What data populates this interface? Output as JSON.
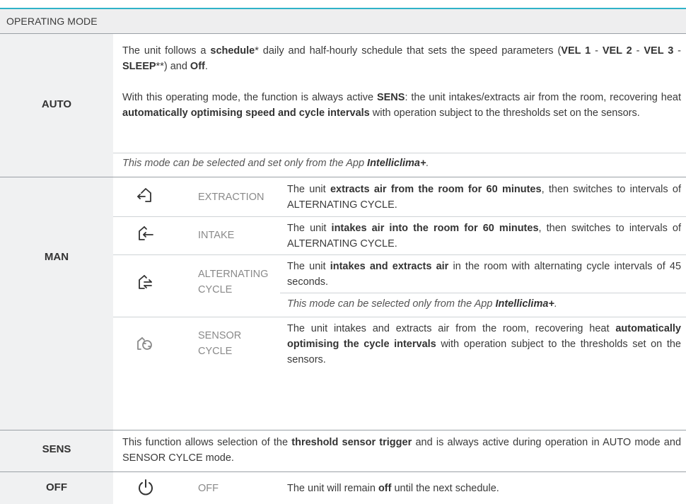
{
  "header": {
    "title": "OPERATING MODE"
  },
  "auto": {
    "label": "AUTO",
    "p1": {
      "a": "The unit follows a ",
      "b1": "schedule",
      "c": "* daily and half-hourly schedule that sets the speed parameters (",
      "b2": "VEL 1",
      "d": " - ",
      "b3": "VEL 2",
      "e": " - ",
      "b4": "VEL 3",
      "f": " - ",
      "b5": "SLEEP",
      "g": "**) and ",
      "b6": "Off",
      "h": "."
    },
    "p2": {
      "a": "With this operating mode, the function is always active ",
      "b1": "SENS",
      "c": ": the unit intakes/extracts air from the room, recovering heat ",
      "b2": "automatically optimising speed and cycle intervals",
      "d": " with operation subject to the thresholds set on the sensors."
    },
    "note": {
      "a": "This mode can be selected and set only from the App ",
      "b": "Intelliclima+",
      "c": "."
    }
  },
  "man": {
    "label": "MAN",
    "modes": [
      {
        "icon": "extraction-icon",
        "name": "EXTRACTION",
        "t1": "The unit ",
        "b1": "extracts air from the room for 60 minutes",
        "t2": ", then switches to intervals of ALTERNATING CYCLE."
      },
      {
        "icon": "intake-icon",
        "name": "INTAKE",
        "t1": "The unit ",
        "b1": "intakes air into the room for 60 minutes",
        "t2": ", then switches to intervals of ALTERNATING CYCLE."
      },
      {
        "icon": "alternating-cycle-icon",
        "name": "ALTERNATING CYCLE",
        "t1": "The unit ",
        "b1": "intakes and extracts air",
        "t2": " in the room with alternating cycle intervals of 45 seconds.",
        "note_a": "This mode can be selected only from the App ",
        "note_b": "Intelliclima+",
        "note_c": "."
      },
      {
        "icon": "sensor-cycle-icon",
        "name": "SENSOR CYCLE",
        "t1": "The unit intakes and extracts air from the room, recovering heat ",
        "b1": "automatically optimising the cycle intervals",
        "t2": " with operation subject to the thresholds set on the sensors."
      }
    ]
  },
  "sens": {
    "label": "SENS",
    "a": "This function allows selection of the ",
    "b": "threshold sensor trigger",
    "c": " and is always active during operation in AUTO mode and SENSOR CYLCE mode."
  },
  "off": {
    "label": "OFF",
    "icon": "power-icon",
    "name": "OFF",
    "a": "The unit will remain ",
    "b": "off",
    "c": " until the next schedule."
  },
  "colors": {
    "accent": "#2fb3c8",
    "header_bg": "#eeeeef",
    "label_bg": "#f0f1f2",
    "icon_dark": "#333333",
    "icon_muted": "#8a8a8a"
  }
}
